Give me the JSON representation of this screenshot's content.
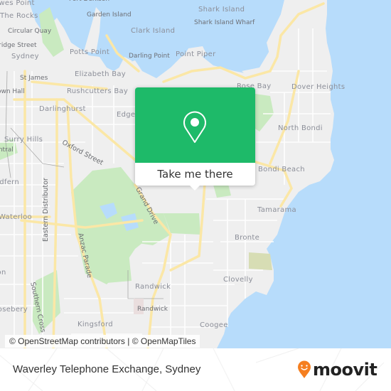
{
  "map": {
    "labels": {
      "the_rocks": "The Rocks",
      "circular_quay": "Circular Quay",
      "bridge_street": "Bridge Street",
      "sydney": "Sydney",
      "st_james": "St James",
      "town_hall": "Town Hall",
      "darlinghurst": "Darlinghurst",
      "surry_hills": "Surry Hills",
      "central": "Central",
      "redfern": "Redfern",
      "waterloo": "Waterloo",
      "rosebery": "Rosebery",
      "kensington": "Kensington",
      "kingsford": "Kingsford",
      "garden_island": "Garden Island",
      "potts_point": "Potts Point",
      "elizabeth_bay": "Elizabeth Bay",
      "rushcutters_bay": "Rushcutters Bay",
      "darling_point": "Darling Point",
      "clark_island": "Clark Island",
      "point_piper": "Point Piper",
      "shark_island": "Shark Island",
      "shark_island_wharf": "Shark Island Wharf",
      "edgecliff": "Edgecliff",
      "rose_bay": "Rose Bay",
      "dover_heights": "Dover Heights",
      "north_bondi": "North Bondi",
      "bondi_beach": "Bondi Beach",
      "tamarama": "Tamarama",
      "bronte": "Bronte",
      "clovelly": "Clovelly",
      "randwick": "Randwick",
      "randwick_stop": "Randwick",
      "coogee": "Coogee",
      "oxford_street": "Oxford Street",
      "eastern_distributor": "Eastern Distributor",
      "anzac_parade": "Anzac Parade",
      "southern_cross": "Southern Cross",
      "grand_drive": "Grand Drive",
      "fort_denison": "Fort Denison",
      "moores_point": "Dawes Point"
    },
    "popup": {
      "button_label": "Take me there",
      "icon": "map-pin-icon",
      "color": "#1eba69"
    },
    "attribution": "© OpenStreetMap contributors | © OpenMapTiles",
    "colors": {
      "water": "#b7dcfb",
      "land": "#efefef",
      "park": "#c9eac0",
      "major_road": "#fbe7a6",
      "minor_road": "#ffffff"
    }
  },
  "footer": {
    "place_name": "Waverley Telephone Exchange, Sydney",
    "brand": "moovit",
    "brand_color": "#f57f20"
  }
}
